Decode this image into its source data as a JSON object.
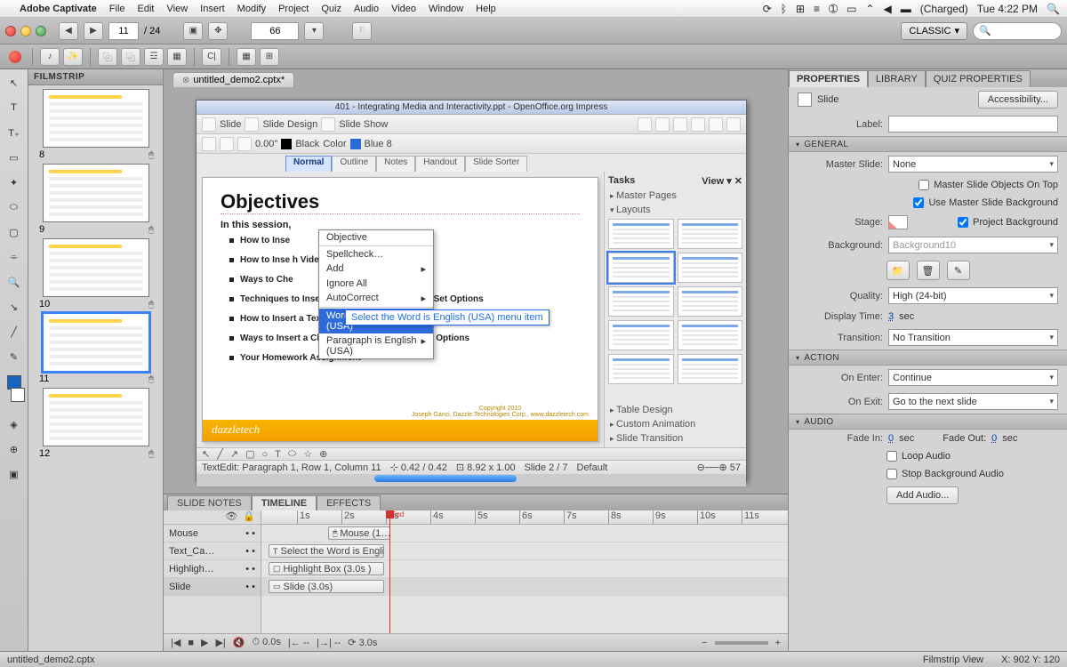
{
  "macbar": {
    "app": "Adobe Captivate",
    "menus": [
      "File",
      "Edit",
      "View",
      "Insert",
      "Modify",
      "Project",
      "Quiz",
      "Audio",
      "Video",
      "Window",
      "Help"
    ],
    "battery": "(Charged)",
    "clock": "Tue 4:22 PM"
  },
  "toolbar1": {
    "slide_current": "11",
    "slide_total": "/  24",
    "zoom": "66",
    "workspace": "CLASSIC"
  },
  "doc_tab": "untitled_demo2.cptx*",
  "filmstrip": {
    "title": "FILMSTRIP",
    "items": [
      {
        "n": "8"
      },
      {
        "n": "9"
      },
      {
        "n": "10"
      },
      {
        "n": "11",
        "selected": true
      },
      {
        "n": "12"
      }
    ]
  },
  "openoffice": {
    "title": "401 - Integrating Media and Interactivity.ppt - OpenOffice.org Impress",
    "tb_slide": "Slide",
    "tb_design": "Slide Design",
    "tb_show": "Slide Show",
    "tb_black": "Black",
    "tb_color": "Color",
    "tb_blue": "Blue 8",
    "tb_width": "0.00\"",
    "tabs": [
      "Normal",
      "Outline",
      "Notes",
      "Handout",
      "Slide Sorter"
    ],
    "slide": {
      "heading": "Objectives",
      "sub": "In this session,",
      "bullets": [
        "How to Inse",
        "How to Inse                                     h Videos",
        "Ways to Che",
        "Techniques to Insert a Button Interaction and Set Options",
        "How to Insert a Text Entry Interaction and Set Options",
        "Ways to Insert a Click Box Interaction and Set Options",
        "Your Homework Assignment"
      ],
      "brand": "dazzletech",
      "copy": "Copyright 2010\nJoseph Ganci, Dazzle Technologies Corp., www.dazzletech.com"
    },
    "context_menu": [
      "Objective",
      "Spellcheck…",
      "Add",
      "Ignore All",
      "AutoCorrect",
      "Word is English (USA)",
      "Paragraph is English (USA)"
    ],
    "context_hl_index": 5,
    "hint": "Select the Word is English (USA) menu item",
    "task": {
      "title": "Tasks",
      "view": "View",
      "sect1": "Master Pages",
      "sect2": "Layouts",
      "foot": [
        "Table Design",
        "Custom Animation",
        "Slide Transition"
      ]
    },
    "status_left": "TextEdit: Paragraph 1, Row 1, Column 11",
    "status_pct": "0.42 / 0.42",
    "status_size": "8.92 x 1.00",
    "status_slide": "Slide 2 / 7",
    "status_default": "Default",
    "status_pct2": "57"
  },
  "timeline": {
    "tabs": [
      "SLIDE NOTES",
      "TIMELINE",
      "EFFECTS"
    ],
    "active": 1,
    "tracks": [
      {
        "name": "Mouse",
        "clip": "Mouse (1…",
        "start": 75,
        "width": 70
      },
      {
        "name": "Text_Ca…",
        "clip": "Select the Word is English …",
        "start": 8,
        "width": 130
      },
      {
        "name": "Highligh…",
        "clip": "Highlight Box (3.0s )",
        "start": 8,
        "width": 130
      },
      {
        "name": "Slide",
        "clip": "Slide (3.0s)",
        "start": 8,
        "width": 130
      }
    ],
    "ticks": [
      "1s",
      "2s",
      "3s",
      "4s",
      "5s",
      "6s",
      "7s",
      "8s",
      "9s",
      "10s",
      "11s"
    ],
    "end_label": "End",
    "ctl_time1": "0.0s",
    "ctl_time2": "3.0s"
  },
  "props": {
    "tabs": [
      "PROPERTIES",
      "LIBRARY",
      "QUIZ PROPERTIES"
    ],
    "kind": "Slide",
    "accessibility": "Accessibility...",
    "label_key": "Label:",
    "sections": {
      "general": "GENERAL",
      "action": "ACTION",
      "audio": "AUDIO"
    },
    "master_slide_key": "Master Slide:",
    "master_slide": "None",
    "chk_objects": "Master Slide Objects On Top",
    "chk_usebg": "Use Master Slide Background",
    "stage_key": "Stage:",
    "chk_projbg": "Project Background",
    "bg_key": "Background:",
    "bg_val": "Background10",
    "quality_key": "Quality:",
    "quality": "High (24-bit)",
    "disptime_key": "Display Time:",
    "disptime": "3",
    "disptime_unit": "sec",
    "transition_key": "Transition:",
    "transition": "No Transition",
    "onenter_key": "On Enter:",
    "onenter": "Continue",
    "onexit_key": "On Exit:",
    "onexit": "Go to the next slide",
    "fadein_key": "Fade In:",
    "fadein": "0",
    "fadeout_key": "Fade Out:",
    "fadeout": "0",
    "sec": "sec",
    "chk_loop": "Loop Audio",
    "chk_stopbg": "Stop Background Audio",
    "add_audio": "Add Audio..."
  },
  "status": {
    "file": "untitled_demo2.cptx",
    "view": "Filmstrip View",
    "coords": "X: 902 Y: 120"
  }
}
